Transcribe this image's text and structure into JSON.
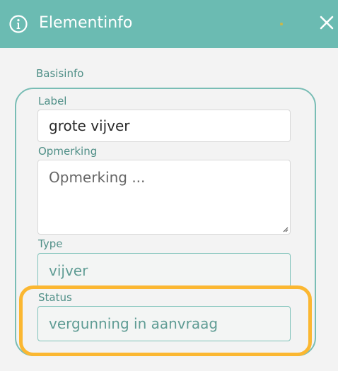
{
  "header": {
    "title": "Elementinfo",
    "icon": "info-icon",
    "close_icon": "close-icon",
    "color": "#6bbbb2"
  },
  "section": {
    "title": "Basisinfo"
  },
  "fields": {
    "label": {
      "label": "Label",
      "value": "grote vijver"
    },
    "opmerking": {
      "label": "Opmerking",
      "placeholder": "Opmerking ..."
    },
    "type": {
      "label": "Type",
      "value": "vijver"
    },
    "status": {
      "label": "Status",
      "value": "vergunning in aanvraag"
    }
  },
  "colors": {
    "accent": "#6bbbb2",
    "highlight": "#fbb731",
    "label_text": "#4f8f87"
  }
}
